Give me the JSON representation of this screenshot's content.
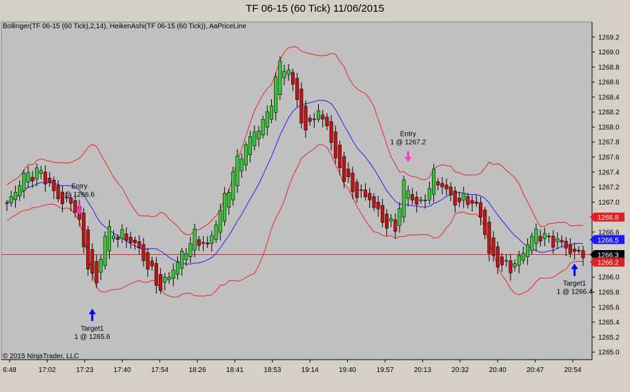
{
  "window": {
    "title": "TF 06-15 (60 Tick)  11/06/2015",
    "indicators_label": "Bollinger(TF 06-15 (60 Tick),2,14), HeikenAshi(TF 06-15 (60 Tick)), AaPriceLine",
    "copyright": "© 2015 NinjaTrader, LLC"
  },
  "chart_data": {
    "type": "candlestick",
    "title": "TF 06-15 (60 Tick)  11/06/2015",
    "y_range": [
      1264.9,
      1269.4
    ],
    "y_ticks": [
      "1269.2",
      "1269.0",
      "1268.8",
      "1268.6",
      "1268.4",
      "1268.2",
      "1268.0",
      "1267.8",
      "1267.6",
      "1267.4",
      "1267.2",
      "1267.0",
      "1266.6",
      "1266.0",
      "1265.8",
      "1265.6",
      "1265.4",
      "1265.2",
      "1265.0"
    ],
    "x_ticks": [
      "6:48",
      "17:02",
      "17:23",
      "17:40",
      "17:54",
      "18:26",
      "18:41",
      "18:53",
      "19:14",
      "19:40",
      "19:57",
      "20:13",
      "20:32",
      "20:40",
      "20:47",
      "20:54"
    ],
    "price_markers": [
      {
        "label": "1266.8",
        "value": 1266.8,
        "color": "#e02020"
      },
      {
        "label": "1266.5",
        "value": 1266.5,
        "color": "#1a1aff"
      },
      {
        "label": "1266.3",
        "value": 1266.3,
        "color": "#000000"
      },
      {
        "label": "1266.2",
        "value": 1266.2,
        "color": "#e02020"
      }
    ],
    "price_line": 1266.3,
    "annotations": [
      {
        "type": "entry",
        "lines": [
          "Entry",
          "@ 1266.6"
        ],
        "bar": 17,
        "price": 1266.85,
        "arrow": "down",
        "color": "#ff33cc"
      },
      {
        "type": "target",
        "lines": [
          "Target1",
          "1 @ 1265.6"
        ],
        "bar": 20,
        "price": 1265.58,
        "arrow": "up",
        "color": "#0000ff"
      },
      {
        "type": "entry",
        "lines": [
          "Entry",
          "1 @ 1267.2"
        ],
        "bar": 94,
        "price": 1267.55,
        "arrow": "down",
        "color": "#ff33cc"
      },
      {
        "type": "target",
        "lines": [
          "Target1",
          "1 @ 1266.4"
        ],
        "bar": 133,
        "price": 1266.18,
        "arrow": "up",
        "color": "#0000ff"
      }
    ],
    "bars_count": 136,
    "anchors": [
      [
        0,
        1266.95
      ],
      [
        4,
        1267.35
      ],
      [
        8,
        1267.4
      ],
      [
        12,
        1267.05
      ],
      [
        16,
        1266.95
      ],
      [
        19,
        1266.15
      ],
      [
        21,
        1265.9
      ],
      [
        23,
        1266.6
      ],
      [
        27,
        1266.55
      ],
      [
        30,
        1266.45
      ],
      [
        33,
        1266.15
      ],
      [
        36,
        1265.85
      ],
      [
        40,
        1266.2
      ],
      [
        44,
        1266.55
      ],
      [
        47,
        1266.4
      ],
      [
        51,
        1267.05
      ],
      [
        54,
        1267.55
      ],
      [
        57,
        1267.85
      ],
      [
        61,
        1268.15
      ],
      [
        64,
        1268.85
      ],
      [
        66,
        1268.75
      ],
      [
        68,
        1268.35
      ],
      [
        70,
        1267.9
      ],
      [
        72,
        1268.2
      ],
      [
        75,
        1268.05
      ],
      [
        77,
        1267.55
      ],
      [
        79,
        1267.35
      ],
      [
        81,
        1267.15
      ],
      [
        85,
        1267.05
      ],
      [
        88,
        1266.75
      ],
      [
        91,
        1266.65
      ],
      [
        93,
        1267.25
      ],
      [
        95,
        1267.05
      ],
      [
        97,
        1266.95
      ],
      [
        100,
        1267.35
      ],
      [
        103,
        1267.15
      ],
      [
        105,
        1267.0
      ],
      [
        108,
        1267.05
      ],
      [
        111,
        1266.85
      ],
      [
        113,
        1266.3
      ],
      [
        116,
        1266.15
      ],
      [
        119,
        1266.15
      ],
      [
        122,
        1266.45
      ],
      [
        124,
        1266.6
      ],
      [
        127,
        1266.5
      ],
      [
        130,
        1266.45
      ],
      [
        133,
        1266.3
      ],
      [
        135,
        1266.35
      ]
    ]
  }
}
